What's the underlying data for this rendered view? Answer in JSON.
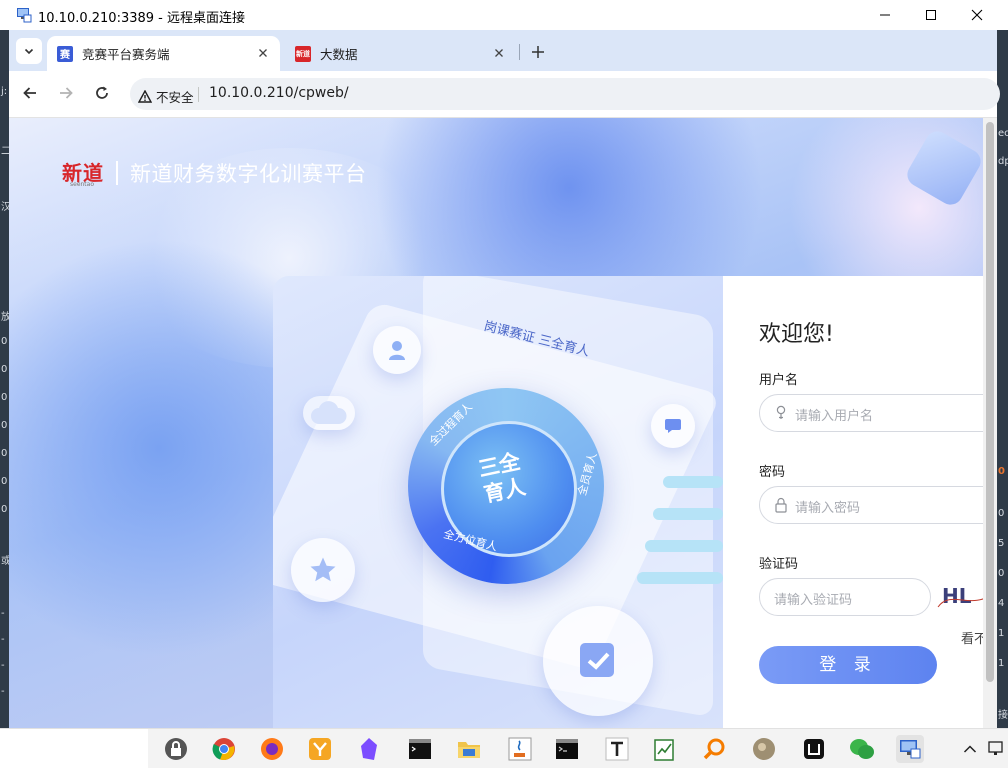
{
  "window": {
    "title": "10.10.0.210:3389 - 远程桌面连接"
  },
  "browser": {
    "tabs": [
      {
        "label": "竞赛平台赛务端",
        "favicon_text": "赛",
        "active": true
      },
      {
        "label": "大数据",
        "favicon_text": "新道",
        "active": false
      }
    ],
    "address": {
      "security_label": "不安全",
      "url": "10.10.0.210/cpweb/"
    }
  },
  "page": {
    "logo_text": "新道",
    "logo_sub": "seentao",
    "platform_name": "新道财务数字化训赛平台",
    "illustration": {
      "tag": "岗课赛证  三全育人",
      "center": "三全\n育人",
      "arc_left": "全过程育人",
      "arc_right": "全员育人",
      "arc_bottom": "全方位育人"
    },
    "login": {
      "welcome": "欢迎您!",
      "username_label": "用户名",
      "username_placeholder": "请输入用户名",
      "password_label": "密码",
      "password_placeholder": "请输入密码",
      "captcha_label": "验证码",
      "captcha_placeholder": "请输入验证码",
      "captcha_image_text": "HL",
      "captcha_tip": "看不",
      "login_button": "登 录"
    }
  },
  "side_text": {
    "left": [
      "j:",
      "二",
      "汉",
      "放",
      "0",
      "0",
      "0",
      "0",
      "0",
      "0",
      "0",
      "或",
      "-",
      "-",
      "-",
      "-"
    ],
    "right": [
      "ec",
      "dp",
      "0",
      "0",
      "5",
      "0",
      "4",
      "1",
      "1",
      "接"
    ]
  },
  "taskbar": {
    "icons": [
      "lock-icon",
      "chrome-icon",
      "firefox-icon",
      "yuque-icon",
      "obsidian-icon",
      "terminal-icon",
      "folder-icon",
      "java-icon",
      "cmd-icon",
      "typora-icon",
      "notepad-icon",
      "search-tool-icon",
      "avatar-app-icon",
      "app-icon",
      "wechat-icon",
      "remote-desktop-icon"
    ],
    "tray_chevron": "chevron-up-icon"
  }
}
